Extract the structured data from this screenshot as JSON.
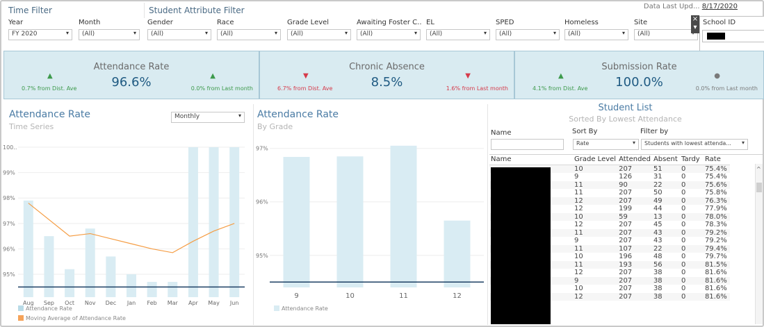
{
  "filters": {
    "time_filter_title": "Time Filter",
    "student_filter_title": "Student Attribute Filter",
    "data_updated_label": "Data Last Upd...",
    "data_updated_date": "8/17/2020",
    "items": [
      {
        "label": "Year",
        "value": "FY 2020"
      },
      {
        "label": "Month",
        "value": "(All)"
      },
      {
        "label": "Gender",
        "value": "(All)"
      },
      {
        "label": "Race",
        "value": "(All)"
      },
      {
        "label": "Grade Level",
        "value": "(All)"
      },
      {
        "label": "Awaiting Foster C..",
        "value": "(All)"
      },
      {
        "label": "EL",
        "value": "(All)"
      },
      {
        "label": "SPED",
        "value": "(All)"
      },
      {
        "label": "Homeless",
        "value": "(All)"
      },
      {
        "label": "Site",
        "value": "(All)"
      }
    ],
    "school_id_label": "School ID",
    "close_symbol": "×"
  },
  "kpis": [
    {
      "title": "Attendance Rate",
      "value": "96.6%",
      "left_note": "0.7% from Dist. Ave",
      "left_dir": "up",
      "right_note": "0.0% from Last month",
      "right_dir": "up"
    },
    {
      "title": "Chronic Absence",
      "value": "8.5%",
      "left_note": "6.7% from Dist. Ave",
      "left_dir": "down",
      "right_note": "1.6% from Last month",
      "right_dir": "down"
    },
    {
      "title": "Submission Rate",
      "value": "100.0%",
      "left_note": "4.1% from Dist. Ave",
      "left_dir": "up",
      "right_note": "0.0% from Last month",
      "right_dir": "neutral"
    }
  ],
  "time_series": {
    "title": "Attendance Rate",
    "subtitle": "Time Series",
    "period_select": "Monthly",
    "legend_bar": "Attendance Rate",
    "legend_line": "Moving Average of Attendance Rate"
  },
  "by_grade": {
    "title": "Attendance Rate",
    "subtitle": "By Grade",
    "legend_bar": "Attendance Rate"
  },
  "student_list": {
    "title": "Student List",
    "subtitle": "Sorted By Lowest Attendance",
    "name_label": "Name",
    "sort_label": "Sort By",
    "sort_value": "Rate",
    "filter_label": "Filter by",
    "filter_value": "Students with lowest attenda...",
    "columns": [
      "Name",
      "Grade Level",
      "Attended",
      "Absent",
      "Tardy",
      "Rate"
    ],
    "rows": [
      {
        "grade": "10",
        "attended": "207",
        "absent": "51",
        "tardy": "0",
        "rate": "75.4%"
      },
      {
        "grade": "9",
        "attended": "126",
        "absent": "31",
        "tardy": "0",
        "rate": "75.4%"
      },
      {
        "grade": "11",
        "attended": "90",
        "absent": "22",
        "tardy": "0",
        "rate": "75.6%"
      },
      {
        "grade": "11",
        "attended": "207",
        "absent": "50",
        "tardy": "0",
        "rate": "75.8%"
      },
      {
        "grade": "12",
        "attended": "207",
        "absent": "49",
        "tardy": "0",
        "rate": "76.3%"
      },
      {
        "grade": "12",
        "attended": "199",
        "absent": "44",
        "tardy": "0",
        "rate": "77.9%"
      },
      {
        "grade": "10",
        "attended": "59",
        "absent": "13",
        "tardy": "0",
        "rate": "78.0%"
      },
      {
        "grade": "12",
        "attended": "207",
        "absent": "45",
        "tardy": "0",
        "rate": "78.3%"
      },
      {
        "grade": "11",
        "attended": "207",
        "absent": "43",
        "tardy": "0",
        "rate": "79.2%"
      },
      {
        "grade": "9",
        "attended": "207",
        "absent": "43",
        "tardy": "0",
        "rate": "79.2%"
      },
      {
        "grade": "11",
        "attended": "107",
        "absent": "22",
        "tardy": "0",
        "rate": "79.4%"
      },
      {
        "grade": "10",
        "attended": "196",
        "absent": "48",
        "tardy": "0",
        "rate": "79.7%"
      },
      {
        "grade": "11",
        "attended": "193",
        "absent": "56",
        "tardy": "0",
        "rate": "81.5%"
      },
      {
        "grade": "12",
        "attended": "207",
        "absent": "38",
        "tardy": "0",
        "rate": "81.6%"
      },
      {
        "grade": "9",
        "attended": "207",
        "absent": "38",
        "tardy": "0",
        "rate": "81.6%"
      },
      {
        "grade": "10",
        "attended": "207",
        "absent": "38",
        "tardy": "0",
        "rate": "81.6%"
      },
      {
        "grade": "12",
        "attended": "207",
        "absent": "38",
        "tardy": "0",
        "rate": "81.6%"
      }
    ]
  },
  "colors": {
    "bar": "#d9ecf3",
    "moving_average": "#f59d44",
    "reference_line": "#1c3f63",
    "up": "#3d9a4c",
    "down": "#d63a4a"
  },
  "chart_data": [
    {
      "type": "bar",
      "title": "Attendance Rate",
      "subtitle": "Time Series",
      "categories": [
        "Aug",
        "Sep",
        "Oct",
        "Nov",
        "Dec",
        "Jan",
        "Feb",
        "Mar",
        "Apr",
        "May",
        "Jun"
      ],
      "series": [
        {
          "name": "Attendance Rate",
          "type": "bar",
          "values": [
            97.9,
            96.5,
            95.2,
            96.8,
            95.7,
            95.0,
            94.7,
            94.7,
            100,
            100,
            100
          ]
        },
        {
          "name": "Moving Average of Attendance Rate",
          "type": "line",
          "values": [
            97.8,
            null,
            96.5,
            96.6,
            96.4,
            96.2,
            96.0,
            95.85,
            96.3,
            96.7,
            97.0
          ]
        }
      ],
      "reference_line": 94.5,
      "ylim": [
        94,
        100
      ],
      "yticks": [
        "95%",
        "96%",
        "97%",
        "98%",
        "99%",
        "100.."
      ],
      "legend_position": "bottom"
    },
    {
      "type": "bar",
      "title": "Attendance Rate",
      "subtitle": "By Grade",
      "categories": [
        "9",
        "10",
        "11",
        "12"
      ],
      "series": [
        {
          "name": "Attendance Rate",
          "values": [
            96.84,
            96.85,
            97.05,
            95.65
          ]
        }
      ],
      "reference_line": 94.5,
      "ylim": [
        94.4,
        97.1
      ],
      "yticks": [
        "95%",
        "96%",
        "97%"
      ],
      "legend_position": "bottom"
    }
  ]
}
